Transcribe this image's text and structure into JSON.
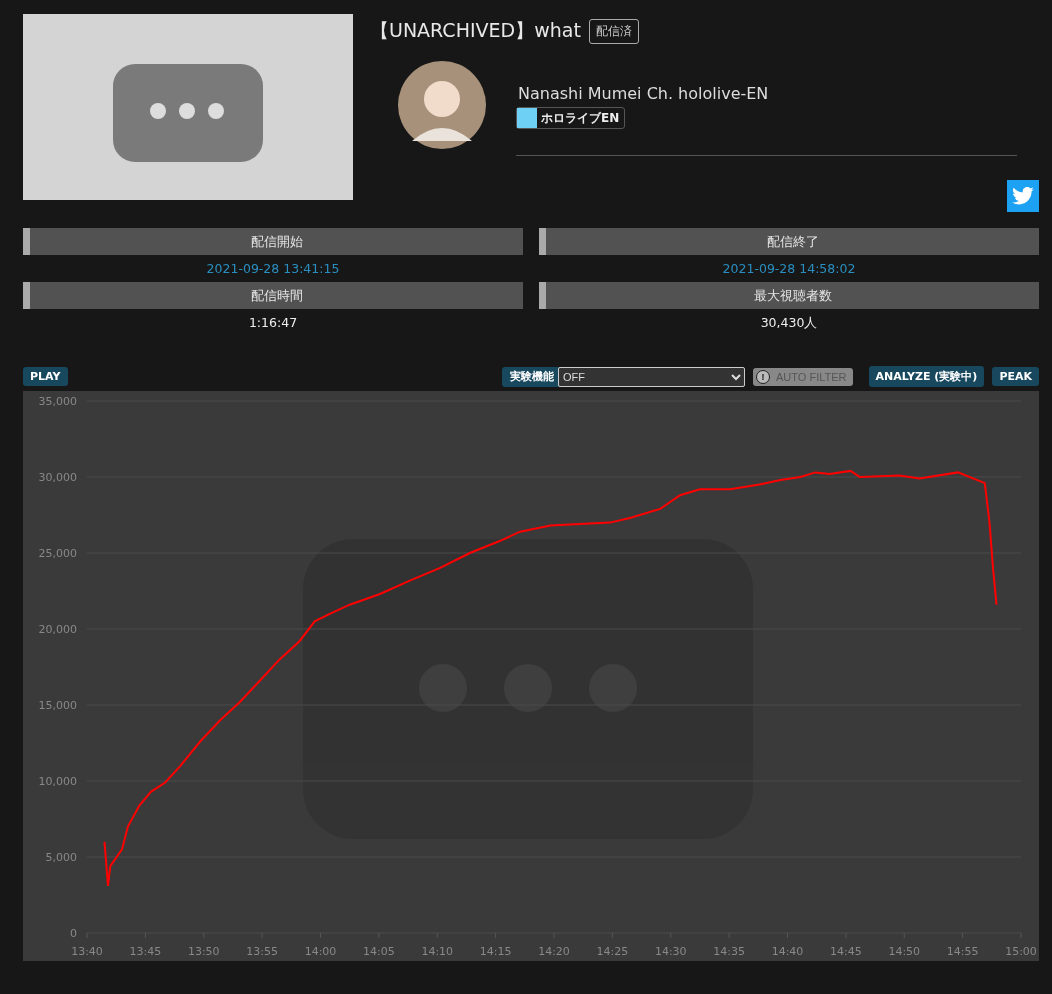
{
  "video": {
    "kind": "picture",
    "title": "【UNARCHIVED】what",
    "status_badge": "配信済"
  },
  "channel": {
    "name": "Nanashi Mumei Ch. hololive-EN",
    "group": "ホロライブEN"
  },
  "stats": [
    {
      "label": "配信開始",
      "value": "2021-09-28 13:41:15",
      "link": true
    },
    {
      "label": "配信終了",
      "value": "2021-09-28 14:58:02",
      "link": true
    },
    {
      "label": "配信時間",
      "value": "1:16:47",
      "link": false
    },
    {
      "label": "最大視聴者数",
      "value": "30,430人",
      "link": false
    }
  ],
  "toolbar": {
    "play": "PLAY",
    "experimental_label": "実験機能",
    "experimental_select": "OFF",
    "auto_filter": {
      "label": "AUTO FILTER",
      "icon": "!",
      "disabled": true
    },
    "analyze": "ANALYZE (実験中)",
    "peak": "PEAK"
  },
  "chart": {
    "chart_data": {
      "type": "line",
      "x": [
        821.5,
        821.8,
        822,
        823,
        823.5,
        824.5,
        825.5,
        826.7,
        828,
        829.7,
        831.4,
        833.1,
        834.8,
        836.5,
        838.2,
        839.5,
        840.8,
        842.5,
        845.1,
        847.7,
        850.2,
        852.8,
        855.4,
        857.1,
        859.7,
        862.2,
        864.8,
        866.5,
        869.1,
        870.8,
        872.5,
        875.1,
        877.6,
        879.4,
        881.1,
        882.4,
        883.6,
        885.4,
        886.2,
        889.6,
        891.3,
        894.6,
        896.9,
        897.3,
        897.6,
        897.9
      ],
      "series": [
        {
          "color": "#ff0000",
          "values": [
            6000,
            3100,
            4400,
            5500,
            7000,
            8400,
            9300,
            9900,
            11000,
            12600,
            14000,
            15200,
            16600,
            18000,
            19200,
            20500,
            21000,
            21600,
            22300,
            23200,
            24000,
            25000,
            25800,
            26400,
            26800,
            26900,
            27000,
            27300,
            27900,
            28800,
            29200,
            29200,
            29500,
            29800,
            30000,
            30300,
            30200,
            30400,
            30000,
            30100,
            29900,
            30300,
            29600,
            27000,
            24000,
            21600
          ]
        }
      ],
      "grid": true,
      "xlim": [
        820,
        900
      ],
      "ylim": [
        0,
        35000
      ],
      "xticks": [
        {
          "value": 820,
          "label": "13:40"
        },
        {
          "value": 825,
          "label": "13:45"
        },
        {
          "value": 830,
          "label": "13:50"
        },
        {
          "value": 835,
          "label": "13:55"
        },
        {
          "value": 840,
          "label": "14:00"
        },
        {
          "value": 845,
          "label": "14:05"
        },
        {
          "value": 850,
          "label": "14:10"
        },
        {
          "value": 855,
          "label": "14:15"
        },
        {
          "value": 860,
          "label": "14:20"
        },
        {
          "value": 865,
          "label": "14:25"
        },
        {
          "value": 870,
          "label": "14:30"
        },
        {
          "value": 875,
          "label": "14:35"
        },
        {
          "value": 880,
          "label": "14:40"
        },
        {
          "value": 885,
          "label": "14:45"
        },
        {
          "value": 890,
          "label": "14:50"
        },
        {
          "value": 895,
          "label": "14:55"
        },
        {
          "value": 900,
          "label": "15:00"
        }
      ],
      "yticks": [
        {
          "value": 0,
          "label": "0"
        },
        {
          "value": 5000,
          "label": "5,000"
        },
        {
          "value": 10000,
          "label": "10,000"
        },
        {
          "value": 15000,
          "label": "15,000"
        },
        {
          "value": 20000,
          "label": "20,000"
        },
        {
          "value": 25000,
          "label": "25,000"
        },
        {
          "value": 30000,
          "label": "30,000"
        },
        {
          "value": 35000,
          "label": "35,000"
        }
      ]
    }
  }
}
